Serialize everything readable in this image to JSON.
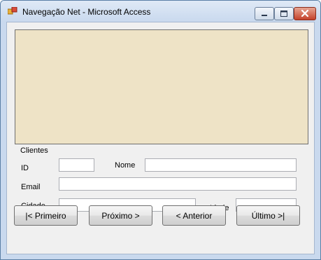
{
  "window": {
    "title": "Navegação Net - Microsoft Access"
  },
  "group": {
    "label": "Clientes"
  },
  "fields": {
    "id_label": "ID",
    "id_value": "",
    "nome_label": "Nome",
    "nome_value": "",
    "email_label": "Email",
    "email_value": "",
    "cidade_label": "Cidade",
    "cidade_value": "",
    "idade_label": "Idade",
    "idade_value": ""
  },
  "buttons": {
    "first": "|< Primeiro",
    "next": "Próximo >",
    "previous": "< Anterior",
    "last": "Último >|"
  },
  "colors": {
    "grid_background": "#eee3c6",
    "form_background": "#f0f0f0",
    "window_frame": "#c9d9ee",
    "close_button": "#c4422b"
  },
  "icons": {
    "app": "access-app-icon",
    "minimize": "minimize-icon",
    "maximize": "maximize-icon",
    "close": "close-icon"
  }
}
